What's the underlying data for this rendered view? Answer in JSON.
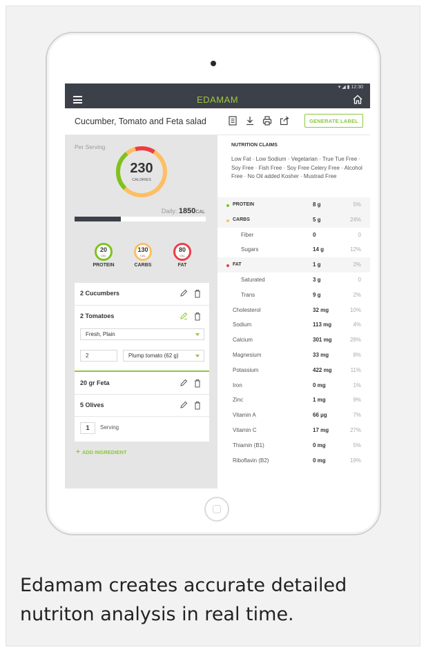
{
  "app": {
    "status_time": "12:30",
    "title": "EDAMAM"
  },
  "recipe": {
    "title": "Cucumber, Tomato and Feta salad",
    "generate_label": "GENERATE LABEL"
  },
  "summary": {
    "per_serving": "Per Serving",
    "calories": "230",
    "calories_label": "CALORIES",
    "daily_prefix": "Daily: ",
    "daily_value": "1850",
    "daily_unit": "CAL",
    "daily_progress": 0.35,
    "macros": [
      {
        "value": "20",
        "unit": "CAL",
        "name": "PROTEIN",
        "color": "#7dc21e"
      },
      {
        "value": "130",
        "unit": "CAL",
        "name": "CARBS",
        "color": "#fdbf62"
      },
      {
        "value": "80",
        "unit": "CAL",
        "name": "FAT",
        "color": "#ec3d46"
      }
    ]
  },
  "ingredients": {
    "items": [
      {
        "label": "2 Cucumbers"
      },
      {
        "label": "2 Tomatoes"
      },
      {
        "label": "20 gr Feta"
      },
      {
        "label": "5 Olives"
      }
    ],
    "tomato_prep": "Fresh, Plain",
    "tomato_qty": "2",
    "tomato_measure": "Plump tomato (62 g)",
    "servings": "1",
    "servings_label": "Serving",
    "add_label": "ADD INGREDIENT"
  },
  "nutrition": {
    "claims_title": "NUTRITION CLAIMS",
    "claims": "Low Fat · Low Sodium · Vegetarian · True Tue Free · Soy Free · Fish Free · Soy Free Celery Free · Alcohol Free · No Oil added Kosher · Mustrad Free",
    "rows": [
      {
        "name": "PROTEIN",
        "value": "8 g",
        "pct": "5%"
      },
      {
        "name": "CARBS",
        "value": "5 g",
        "pct": "24%"
      },
      {
        "name": "Fiber",
        "value": "0",
        "pct": "0"
      },
      {
        "name": "Sugars",
        "value": "14 g",
        "pct": "12%"
      },
      {
        "name": "FAT",
        "value": "1 g",
        "pct": "2%"
      },
      {
        "name": "Saturated",
        "value": "3 g",
        "pct": "0"
      },
      {
        "name": "Trans",
        "value": "9 g",
        "pct": "2%"
      },
      {
        "name": "Cholesterol",
        "value": "32 mg",
        "pct": "10%"
      },
      {
        "name": "Sodium",
        "value": "113 mg",
        "pct": "4%"
      },
      {
        "name": "Calcium",
        "value": "301 mg",
        "pct": "28%"
      },
      {
        "name": "Magnesium",
        "value": "33 mg",
        "pct": "8%"
      },
      {
        "name": "Potassium",
        "value": "422 mg",
        "pct": "11%"
      },
      {
        "name": "Iron",
        "value": "0 mg",
        "pct": "1%"
      },
      {
        "name": "Zinc",
        "value": "1 mg",
        "pct": "9%"
      },
      {
        "name": "Vitamin A",
        "value": "66 µg",
        "pct": "7%"
      },
      {
        "name": "Vitamin C",
        "value": "17 mg",
        "pct": "27%"
      },
      {
        "name": "Thiamin (B1)",
        "value": "0 mg",
        "pct": "5%"
      },
      {
        "name": "Riboflavin (B2)",
        "value": "0 mg",
        "pct": "19%"
      }
    ]
  },
  "caption": "Edamam creates accurate detailed nutriton analysis in real time.",
  "colors": {
    "brand_green": "#8cc63f",
    "protein": "#7dc21e",
    "carbs": "#fdbf62",
    "fat": "#ec3d46",
    "appbar": "#3c4049"
  }
}
